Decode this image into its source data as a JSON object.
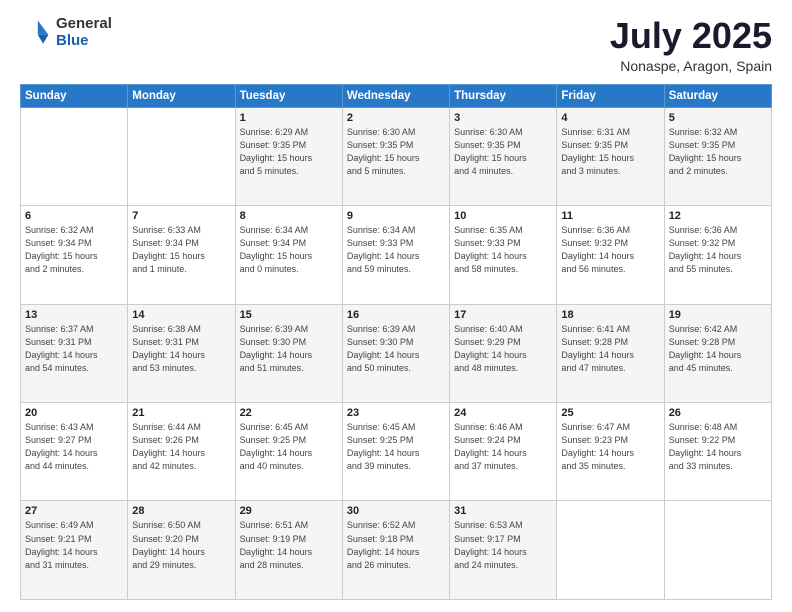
{
  "header": {
    "logo_general": "General",
    "logo_blue": "Blue",
    "month": "July 2025",
    "location": "Nonaspe, Aragon, Spain"
  },
  "days_of_week": [
    "Sunday",
    "Monday",
    "Tuesday",
    "Wednesday",
    "Thursday",
    "Friday",
    "Saturday"
  ],
  "weeks": [
    [
      {
        "day": "",
        "info": ""
      },
      {
        "day": "",
        "info": ""
      },
      {
        "day": "1",
        "info": "Sunrise: 6:29 AM\nSunset: 9:35 PM\nDaylight: 15 hours\nand 5 minutes."
      },
      {
        "day": "2",
        "info": "Sunrise: 6:30 AM\nSunset: 9:35 PM\nDaylight: 15 hours\nand 5 minutes."
      },
      {
        "day": "3",
        "info": "Sunrise: 6:30 AM\nSunset: 9:35 PM\nDaylight: 15 hours\nand 4 minutes."
      },
      {
        "day": "4",
        "info": "Sunrise: 6:31 AM\nSunset: 9:35 PM\nDaylight: 15 hours\nand 3 minutes."
      },
      {
        "day": "5",
        "info": "Sunrise: 6:32 AM\nSunset: 9:35 PM\nDaylight: 15 hours\nand 2 minutes."
      }
    ],
    [
      {
        "day": "6",
        "info": "Sunrise: 6:32 AM\nSunset: 9:34 PM\nDaylight: 15 hours\nand 2 minutes."
      },
      {
        "day": "7",
        "info": "Sunrise: 6:33 AM\nSunset: 9:34 PM\nDaylight: 15 hours\nand 1 minute."
      },
      {
        "day": "8",
        "info": "Sunrise: 6:34 AM\nSunset: 9:34 PM\nDaylight: 15 hours\nand 0 minutes."
      },
      {
        "day": "9",
        "info": "Sunrise: 6:34 AM\nSunset: 9:33 PM\nDaylight: 14 hours\nand 59 minutes."
      },
      {
        "day": "10",
        "info": "Sunrise: 6:35 AM\nSunset: 9:33 PM\nDaylight: 14 hours\nand 58 minutes."
      },
      {
        "day": "11",
        "info": "Sunrise: 6:36 AM\nSunset: 9:32 PM\nDaylight: 14 hours\nand 56 minutes."
      },
      {
        "day": "12",
        "info": "Sunrise: 6:36 AM\nSunset: 9:32 PM\nDaylight: 14 hours\nand 55 minutes."
      }
    ],
    [
      {
        "day": "13",
        "info": "Sunrise: 6:37 AM\nSunset: 9:31 PM\nDaylight: 14 hours\nand 54 minutes."
      },
      {
        "day": "14",
        "info": "Sunrise: 6:38 AM\nSunset: 9:31 PM\nDaylight: 14 hours\nand 53 minutes."
      },
      {
        "day": "15",
        "info": "Sunrise: 6:39 AM\nSunset: 9:30 PM\nDaylight: 14 hours\nand 51 minutes."
      },
      {
        "day": "16",
        "info": "Sunrise: 6:39 AM\nSunset: 9:30 PM\nDaylight: 14 hours\nand 50 minutes."
      },
      {
        "day": "17",
        "info": "Sunrise: 6:40 AM\nSunset: 9:29 PM\nDaylight: 14 hours\nand 48 minutes."
      },
      {
        "day": "18",
        "info": "Sunrise: 6:41 AM\nSunset: 9:28 PM\nDaylight: 14 hours\nand 47 minutes."
      },
      {
        "day": "19",
        "info": "Sunrise: 6:42 AM\nSunset: 9:28 PM\nDaylight: 14 hours\nand 45 minutes."
      }
    ],
    [
      {
        "day": "20",
        "info": "Sunrise: 6:43 AM\nSunset: 9:27 PM\nDaylight: 14 hours\nand 44 minutes."
      },
      {
        "day": "21",
        "info": "Sunrise: 6:44 AM\nSunset: 9:26 PM\nDaylight: 14 hours\nand 42 minutes."
      },
      {
        "day": "22",
        "info": "Sunrise: 6:45 AM\nSunset: 9:25 PM\nDaylight: 14 hours\nand 40 minutes."
      },
      {
        "day": "23",
        "info": "Sunrise: 6:45 AM\nSunset: 9:25 PM\nDaylight: 14 hours\nand 39 minutes."
      },
      {
        "day": "24",
        "info": "Sunrise: 6:46 AM\nSunset: 9:24 PM\nDaylight: 14 hours\nand 37 minutes."
      },
      {
        "day": "25",
        "info": "Sunrise: 6:47 AM\nSunset: 9:23 PM\nDaylight: 14 hours\nand 35 minutes."
      },
      {
        "day": "26",
        "info": "Sunrise: 6:48 AM\nSunset: 9:22 PM\nDaylight: 14 hours\nand 33 minutes."
      }
    ],
    [
      {
        "day": "27",
        "info": "Sunrise: 6:49 AM\nSunset: 9:21 PM\nDaylight: 14 hours\nand 31 minutes."
      },
      {
        "day": "28",
        "info": "Sunrise: 6:50 AM\nSunset: 9:20 PM\nDaylight: 14 hours\nand 29 minutes."
      },
      {
        "day": "29",
        "info": "Sunrise: 6:51 AM\nSunset: 9:19 PM\nDaylight: 14 hours\nand 28 minutes."
      },
      {
        "day": "30",
        "info": "Sunrise: 6:52 AM\nSunset: 9:18 PM\nDaylight: 14 hours\nand 26 minutes."
      },
      {
        "day": "31",
        "info": "Sunrise: 6:53 AM\nSunset: 9:17 PM\nDaylight: 14 hours\nand 24 minutes."
      },
      {
        "day": "",
        "info": ""
      },
      {
        "day": "",
        "info": ""
      }
    ]
  ]
}
